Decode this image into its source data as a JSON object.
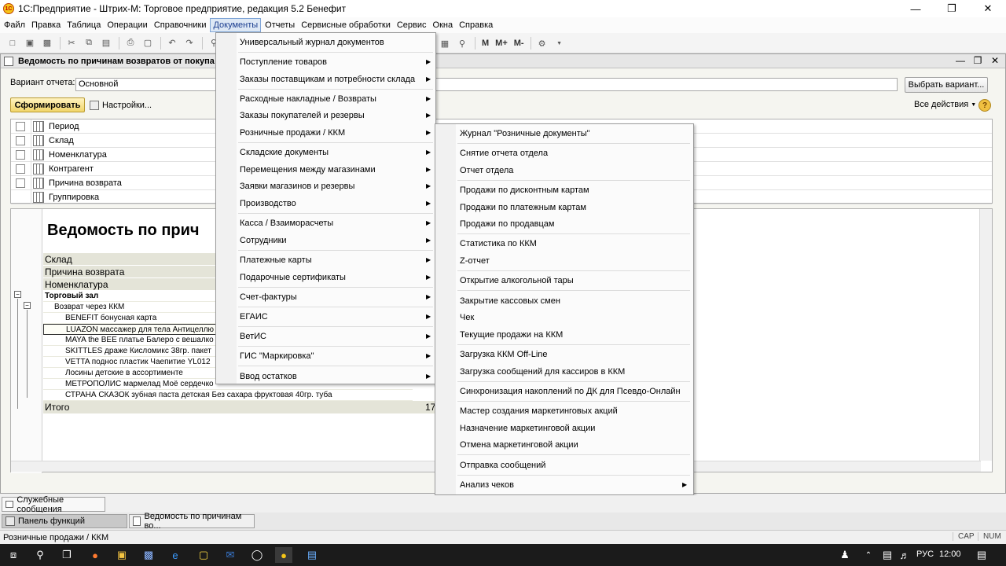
{
  "window": {
    "title": "1С:Предприятие - Штрих-М: Торговое предприятие, редакция 5.2 Бенефит",
    "logo": "1С"
  },
  "menubar": [
    "Файл",
    "Правка",
    "Таблица",
    "Операции",
    "Справочники",
    "Документы",
    "Отчеты",
    "Сервисные обработки",
    "Сервис",
    "Окна",
    "Справка"
  ],
  "toolbar": {
    "m": "M",
    "mplus": "M+",
    "mminus": "M-"
  },
  "doc": {
    "title": "Ведомость по причинам возвратов от покупа",
    "variant_label": "Вариант отчета:",
    "variant_value": "Основной",
    "choose_variant": "Выбрать вариант...",
    "form_button": "Сформировать",
    "settings_button": "Настройки...",
    "all_actions": "Все действия",
    "help": "?",
    "settings_rows": [
      "Период",
      "Склад",
      "Номенклатура",
      "Контрагент",
      "Причина возврата",
      "Группировка"
    ]
  },
  "report": {
    "title": "Ведомость по прич",
    "headers": [
      "Склад",
      "Причина возврата",
      "Номенклатура"
    ],
    "group1": "Торговый зал",
    "group2": "Возврат через ККМ",
    "items": [
      "BENEFIT бонусная карта",
      "LUAZON массажер для тела Антицеллю",
      "MAYA the BEE платье Балеро с вешалко",
      "SKITTLES драже Кисломикс 38гр. пакет",
      "VETTA поднос пластик Чаепитие YL012",
      "Лосины детские в ассортименте",
      "МЕТРОПОЛИС мармелад Моё сердечко",
      "СТРАНА СКАЗОК зубная паста детская Без сахара фруктовая 40гр. туба"
    ],
    "total_label": "Итого",
    "total_value": "17"
  },
  "dropdown": {
    "items": [
      {
        "label": "Универсальный журнал документов",
        "arrow": false
      },
      {
        "label": "Поступление товаров",
        "arrow": true
      },
      {
        "label": "Заказы поставщикам и потребности склада",
        "arrow": true
      },
      {
        "label": "Расходные накладные / Возвраты",
        "arrow": true
      },
      {
        "label": "Заказы покупателей и резервы",
        "arrow": true
      },
      {
        "label": "Розничные продажи / ККМ",
        "arrow": true
      },
      {
        "label": "Складские документы",
        "arrow": true
      },
      {
        "label": "Перемещения между магазинами",
        "arrow": true
      },
      {
        "label": "Заявки магазинов и резервы",
        "arrow": true
      },
      {
        "label": "Производство",
        "arrow": true
      },
      {
        "label": "Касса / Взаиморасчеты",
        "arrow": true
      },
      {
        "label": "Сотрудники",
        "arrow": true
      },
      {
        "label": "Платежные карты",
        "arrow": true
      },
      {
        "label": "Подарочные сертификаты",
        "arrow": true
      },
      {
        "label": "Счет-фактуры",
        "arrow": true
      },
      {
        "label": "ЕГАИС",
        "arrow": true
      },
      {
        "label": "ВетИС",
        "arrow": true
      },
      {
        "label": "ГИС \"Маркировка\"",
        "arrow": true
      },
      {
        "label": "Ввод остатков",
        "arrow": true
      }
    ]
  },
  "submenu": {
    "items": [
      "Журнал \"Розничные документы\"",
      "Снятие отчета отдела",
      "Отчет отдела",
      "Продажи по дисконтным картам",
      "Продажи по платежным картам",
      "Продажи по продавцам",
      "Статистика по ККМ",
      "Z-отчет",
      "Открытие алкогольной тары",
      "Закрытие кассовых смен",
      "Чек",
      "Текущие продажи на ККМ",
      "Загрузка ККМ Off-Line",
      "Загрузка сообщений для кассиров в ККМ",
      "Синхронизация накоплений по ДК для Псевдо-Онлайн",
      "Мастер создания маркетинговых акций",
      "Назначение маркетинговой акции",
      "Отмена маркетинговой акции",
      "Отправка сообщений",
      "Анализ чеков"
    ]
  },
  "bottom": {
    "service_messages": "Служебные сообщения",
    "tab_functions": "Панель функций",
    "tab_report": "Ведомость по причинам во...",
    "status_text": "Розничные продажи / ККМ",
    "cap": "CAP",
    "num": "NUM"
  },
  "taskbar": {
    "lang": "РУС",
    "time": "12:00"
  },
  "colors": {
    "menu_active": "#dde8f5",
    "form_button": "#f1d56a"
  }
}
